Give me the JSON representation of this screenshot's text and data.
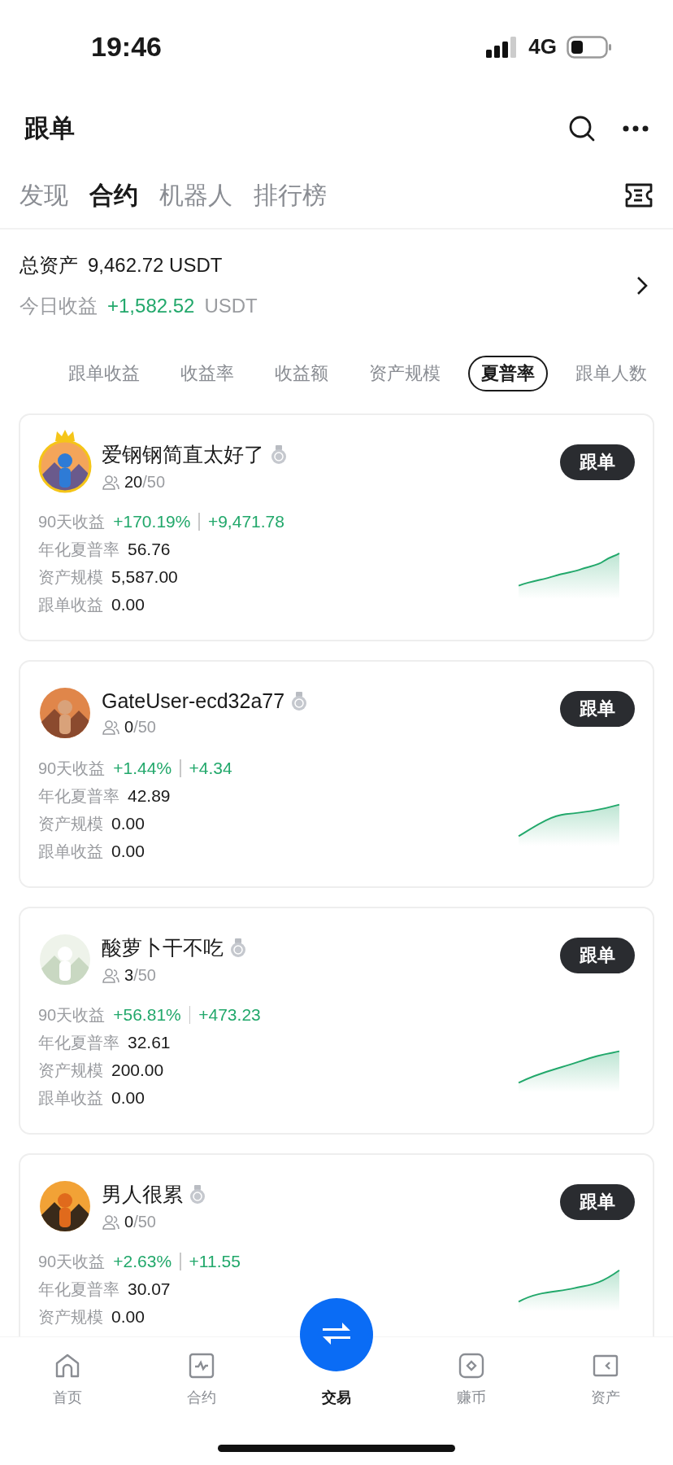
{
  "status_bar": {
    "time": "19:46",
    "network": "4G"
  },
  "header": {
    "title": "跟单"
  },
  "tabs": [
    {
      "label": "发现",
      "selected": false
    },
    {
      "label": "合约",
      "selected": true
    },
    {
      "label": "机器人",
      "selected": false
    },
    {
      "label": "排行榜",
      "selected": false
    }
  ],
  "assets": {
    "total_label": "总资产",
    "total_value": "9,462.72 USDT",
    "today_label": "今日收益",
    "today_value": "+1,582.52",
    "today_unit": "USDT"
  },
  "sort_chips": [
    {
      "label": "跟单收益",
      "selected": false
    },
    {
      "label": "收益率",
      "selected": false
    },
    {
      "label": "收益额",
      "selected": false
    },
    {
      "label": "资产规模",
      "selected": false
    },
    {
      "label": "夏普率",
      "selected": true
    },
    {
      "label": "跟单人数",
      "selected": false
    }
  ],
  "traders": [
    {
      "name": "爱钢钢简直太好了",
      "crowned": true,
      "followers": "20",
      "capacity": "/50",
      "button": "跟单",
      "stats": [
        {
          "label": "90天收益",
          "value": "+170.19%",
          "value_2": "+9,471.78",
          "kind": "profit"
        },
        {
          "label": "年化夏普率",
          "value": "56.76",
          "kind": "plain"
        },
        {
          "label": "资产规模",
          "value": "5,587.00",
          "kind": "plain"
        },
        {
          "label": "跟单收益",
          "value": "0.00",
          "kind": "plain"
        }
      ]
    },
    {
      "name": "GateUser-ecd32a77",
      "crowned": false,
      "followers": "0",
      "capacity": "/50",
      "button": "跟单",
      "stats": [
        {
          "label": "90天收益",
          "value": "+1.44%",
          "value_2": "+4.34",
          "kind": "profit"
        },
        {
          "label": "年化夏普率",
          "value": "42.89",
          "kind": "plain"
        },
        {
          "label": "资产规模",
          "value": "0.00",
          "kind": "plain"
        },
        {
          "label": "跟单收益",
          "value": "0.00",
          "kind": "plain"
        }
      ]
    },
    {
      "name": "酸萝卜干不吃",
      "crowned": false,
      "followers": "3",
      "capacity": "/50",
      "button": "跟单",
      "stats": [
        {
          "label": "90天收益",
          "value": "+56.81%",
          "value_2": "+473.23",
          "kind": "profit"
        },
        {
          "label": "年化夏普率",
          "value": "32.61",
          "kind": "plain"
        },
        {
          "label": "资产规模",
          "value": "200.00",
          "kind": "plain"
        },
        {
          "label": "跟单收益",
          "value": "0.00",
          "kind": "plain"
        }
      ]
    },
    {
      "name": "男人很累",
      "crowned": false,
      "followers": "0",
      "capacity": "/50",
      "button": "跟单",
      "stats": [
        {
          "label": "90天收益",
          "value": "+2.63%",
          "value_2": "+11.55",
          "kind": "profit"
        },
        {
          "label": "年化夏普率",
          "value": "30.07",
          "kind": "plain"
        },
        {
          "label": "资产规模",
          "value": "0.00",
          "kind": "plain"
        }
      ]
    }
  ],
  "bottom_nav": [
    {
      "label": "首页",
      "kind": "tab",
      "selected": false
    },
    {
      "label": "合约",
      "kind": "tab",
      "selected": false
    },
    {
      "label": "交易",
      "kind": "trade",
      "selected": true
    },
    {
      "label": "赚币",
      "kind": "tab",
      "selected": false
    },
    {
      "label": "资产",
      "kind": "tab",
      "selected": false
    }
  ]
}
